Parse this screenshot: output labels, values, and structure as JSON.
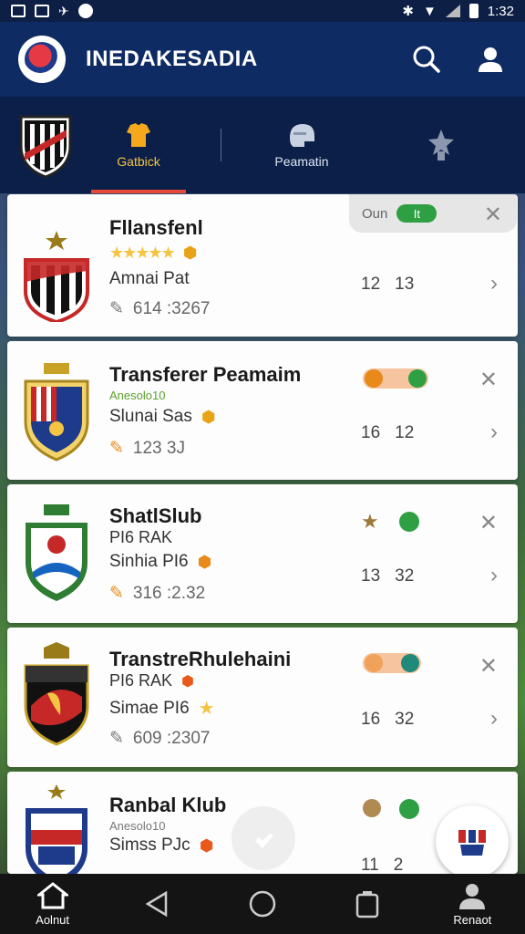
{
  "status_bar": {
    "time": "1:32"
  },
  "app": {
    "title": "INEDAKESADIA"
  },
  "tabs": [
    {
      "label": "Gatbick",
      "icon": "jersey-icon",
      "active": true
    },
    {
      "label": "Peamatin",
      "icon": "helmet-icon",
      "active": false
    },
    {
      "label": "",
      "icon": "trophy-icon",
      "active": false
    }
  ],
  "clubs": [
    {
      "name": "Fllansfenl",
      "sub": "",
      "meta": "Amnai Pat",
      "stat": "614  :3267",
      "nums": [
        "12",
        "13"
      ],
      "pill_label": "Oun",
      "pill_state": "It"
    },
    {
      "name": "Transferer Peamaim",
      "sub": "Anesolo10",
      "meta": "Slunai Sas",
      "stat": "123  3J",
      "nums": [
        "16",
        "12"
      ]
    },
    {
      "name": "ShatlSlub",
      "sub": "PI6 RAK",
      "meta": "Sinhia PI6",
      "stat": "316  :2.32",
      "nums": [
        "13",
        "32"
      ]
    },
    {
      "name": "TranstreRhulehaini",
      "sub": "PI6 RAK",
      "meta": "Simae PI6",
      "stat": "609  :2307",
      "nums": [
        "16",
        "32"
      ]
    },
    {
      "name": "Ranbal Klub",
      "sub": "Anesolo10",
      "meta": "Simss PJc",
      "stat": "",
      "nums": [
        "11",
        "2"
      ]
    }
  ],
  "bottom_nav": {
    "home": "Aolnut",
    "account": "Renaot"
  },
  "colors": {
    "primary": "#0f2b63",
    "accent": "#e84a3a",
    "gold": "#f4c542",
    "green": "#2ea043"
  }
}
